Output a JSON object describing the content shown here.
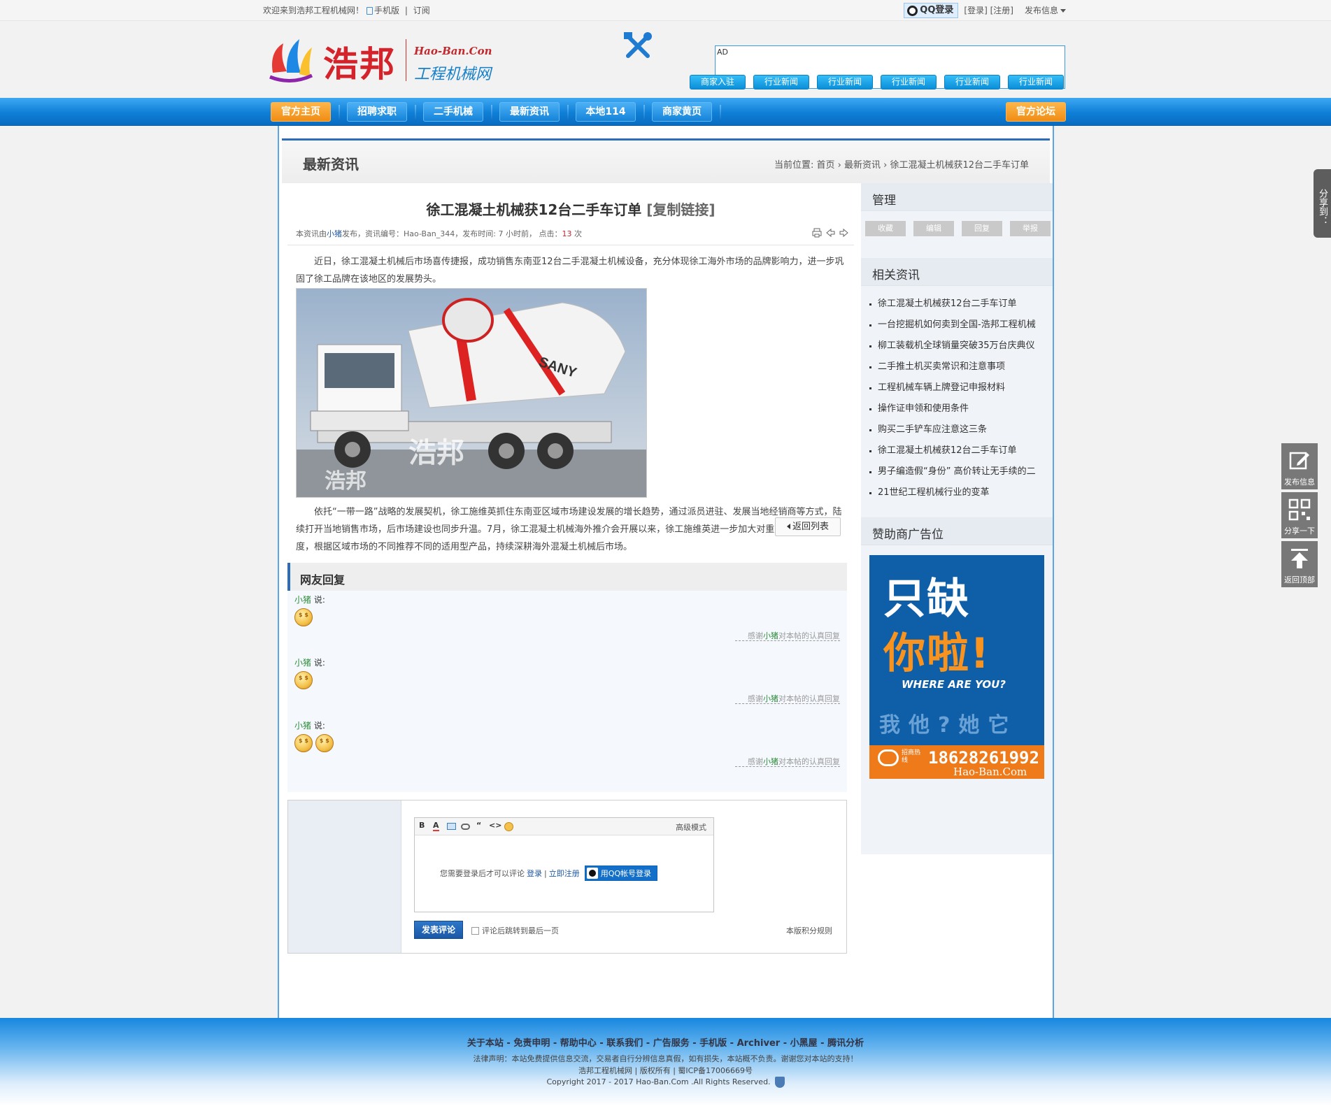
{
  "topbar": {
    "welcome": "欢迎来到浩邦工程机械网！",
    "mobile": "手机版",
    "subscribe": "订阅",
    "qq_login": "QQ登录",
    "login": "[登录]",
    "register": "[注册]",
    "publish": "发布信息"
  },
  "header": {
    "logo_cn": "浩邦",
    "logo_en": "Hao-Ban.Con",
    "logo_sub": "工程机械网",
    "ad_label": "AD",
    "buttons": [
      "商家入驻",
      "行业新闻",
      "行业新闻",
      "行业新闻",
      "行业新闻",
      "行业新闻"
    ]
  },
  "nav": {
    "items": [
      "官方主页",
      "招聘求职",
      "二手机械",
      "最新资讯",
      "本地114",
      "商家黄页"
    ],
    "forum": "官方论坛"
  },
  "section": {
    "title": "最新资讯",
    "crumb": "当前位置: 首页 › 最新资讯 › 徐工混凝土机械获12台二手车订单"
  },
  "article": {
    "title": "徐工混凝土机械获12台二手车订单",
    "copy_link": "[复制链接]",
    "meta_prefix": "本资讯由",
    "author": "小猪",
    "meta_mid": "发布，资讯编号：Hao-Ban_344，发布时间: 7 小时前， 点击：",
    "views": "13",
    "meta_suffix": " 次",
    "para1": "近日，徐工混凝土机械后市场喜传捷报，成功销售东南亚12台二手混凝土机械设备，充分体现徐工海外市场的品牌影响力，进一步巩固了徐工品牌在该地区的发展势头。",
    "para2": "依托“一带一路”战略的发展契机，徐工施维英抓住东南亚区域市场建设发展的增长趋势，通过派员进驻、发展当地经销商等方式，陆续打开当地销售市场，后市场建设也同步升温。7月，徐工混凝土机械海外推介会开展以来，徐工施维英进一步加大对重点区域的建设力度，根据区域市场的不同推荐不同的适用型产品，持续深耕海外混凝土机械后市场。",
    "photo_watermark": "浩邦",
    "photo_brand": "SANY",
    "back": "返回列表"
  },
  "replies": {
    "title": "网友回复",
    "items": [
      {
        "user": "小猪",
        "says": " 说:",
        "thanks_pre": "感谢",
        "thanks_user": "小猪",
        "thanks_post": "对本帖的认真回复"
      },
      {
        "user": "小猪",
        "says": " 说:",
        "thanks_pre": "感谢",
        "thanks_user": "小猪",
        "thanks_post": "对本帖的认真回复"
      },
      {
        "user": "小猪",
        "says": " 说:",
        "thanks_pre": "感谢",
        "thanks_user": "小猪",
        "thanks_post": "对本帖的认真回复"
      }
    ]
  },
  "comment": {
    "advanced": "高级模式",
    "need_login": "您需要登录后才可以评论",
    "login": "登录",
    "sep": "|",
    "register": "立即注册",
    "qq_btn": "用QQ帐号登录",
    "submit": "发表评论",
    "jump_last": "评论后跳转到最后一页",
    "rules": "本版积分规则"
  },
  "sidebar": {
    "manage_title": "管理",
    "manage": [
      "收藏",
      "编辑",
      "回复",
      "举报"
    ],
    "related_title": "相关资讯",
    "related": [
      "徐工混凝土机械获12台二手车订单",
      "一台挖掘机如何卖到全国-浩邦工程机械",
      "柳工装载机全球销量突破35万台庆典仪",
      "二手推土机买卖常识和注意事项",
      "工程机械车辆上牌登记申报材料",
      "操作证申领和使用条件",
      "购买二手铲车应注意这三条",
      "徐工混凝土机械获12台二手车订单",
      "男子编造假“身份” 高价转让无手续的二",
      "21世纪工程机械行业的变革"
    ],
    "sponsor_title": "赞助商广告位",
    "sponsor": {
      "line1": "只缺",
      "line2": "你啦!",
      "where": "WHERE ARE YOU?",
      "row": "我他?她它",
      "label": "招商热线",
      "phone": "18628261992",
      "site": "Hao-Ban.Com"
    }
  },
  "float": {
    "share_tab": "分享到：",
    "publish": "发布信息",
    "share": "分享一下",
    "top": "返回顶部"
  },
  "footer": {
    "links": "关于本站 - 免责申明 - 帮助中心 - 联系我们 - 广告服务 - 手机版 - Archiver - 小黑屋 -  腾讯分析",
    "disclaimer": "法律声明：本站免费提供信息交流，交易者自行分辨信息真假，如有损失，本站概不负责。谢谢您对本站的支持！",
    "rights": "浩邦工程机械网 | 版权所有 | 蜀ICP备17006669号",
    "copyright": "Copyright 2017 - 2017 Hao-Ban.Com .All Rights Reserved."
  }
}
